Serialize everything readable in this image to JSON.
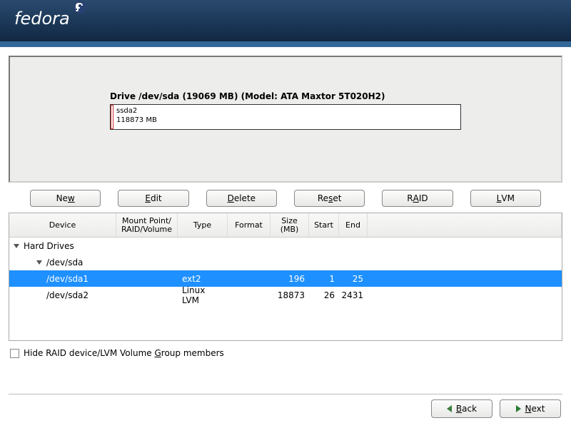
{
  "header": {
    "logo_text": "fedora"
  },
  "drive": {
    "title": "Drive /dev/sda (19069 MB) (Model: ATA Maxtor 5T020H2)",
    "seg2_line1": "ssda2",
    "seg2_line2": "118873 MB"
  },
  "buttons": {
    "new": "New",
    "edit": "Edit",
    "delete": "Delete",
    "reset": "Reset",
    "raid": "RAID",
    "lvm": "LVM"
  },
  "columns": {
    "device": "Device",
    "mount": "Mount Point/\nRAID/Volume",
    "type": "Type",
    "format": "Format",
    "size": "Size\n(MB)",
    "start": "Start",
    "end": "End"
  },
  "rows": {
    "hd": "Hard Drives",
    "sda": "/dev/sda",
    "p1": {
      "device": "/dev/sda1",
      "type": "ext2",
      "size": "196",
      "start": "1",
      "end": "25"
    },
    "p2": {
      "device": "/dev/sda2",
      "type": "Linux LVM",
      "size": "18873",
      "start": "26",
      "end": "2431"
    }
  },
  "checkbox_label": "Hide RAID device/LVM Volume Group members",
  "nav": {
    "back": "Back",
    "next": "Next"
  }
}
